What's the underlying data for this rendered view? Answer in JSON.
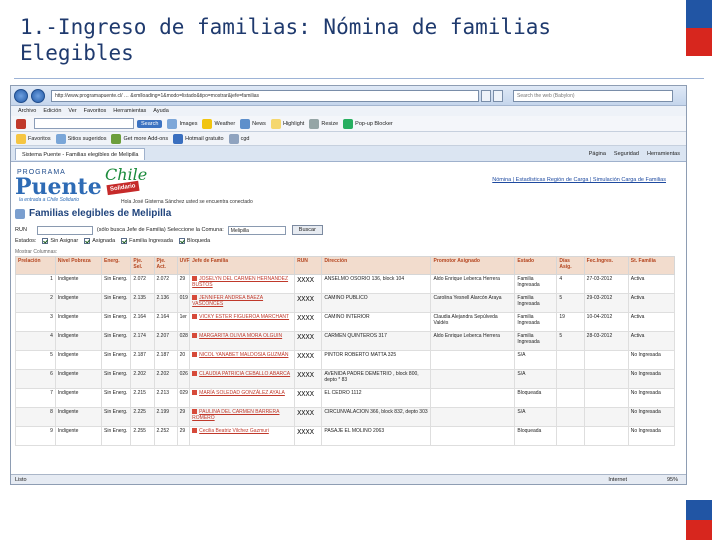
{
  "slide": {
    "title_line1": "1.-Ingreso de familias: Nómina de familias",
    "title_line2": "Elegibles",
    "colors": {
      "flag_blue": "#2155a4",
      "flag_red": "#d7261e",
      "title": "#1f3a6e"
    }
  },
  "browser": {
    "address": "http://www.programapuente.cl/ … &xmlloading=1&modo=listado&tipo=mostrar&jefe=familias",
    "search_placeholder": "Search the web (Babylon)",
    "menu": [
      "Archivo",
      "Edición",
      "Ver",
      "Favoritos",
      "Herramientas",
      "Ayuda"
    ],
    "toolbar1": {
      "search_button": "Search",
      "items": [
        "Images",
        "Weather",
        "News",
        "Highlight",
        "Resize",
        "Pop-up Blocker"
      ]
    },
    "toolbar2": {
      "items": [
        "Favoritos",
        "Sitios sugeridos",
        "Get more Add-ons",
        "Hotmail gratuito",
        "cgd"
      ]
    },
    "tab_title": "Sistema Puente - Familias elegibles de Melipilla",
    "tab_right": [
      "Página",
      "Seguridad",
      "Herramientas"
    ],
    "status_left": "Listo",
    "status_zone": "Internet",
    "status_zoom": "95%"
  },
  "page": {
    "logo": {
      "programa": "PROGRAMA",
      "puente": "Puente",
      "sub": "la entrada a Chile Solidario",
      "chile": "Chile",
      "solidario": "Solidario"
    },
    "top_links": "Nómina | Estadísticas Región de Carga | Simulación Carga de Familias",
    "user_line": "Hola José Gisterna Sánchez usted se encuentra conectado",
    "title": "Familias elegibles de Melipilla",
    "filter": {
      "rut_label": "RUN",
      "hint": "(sólo busca Jefe de Familia) Seleccione la Comuna:",
      "comuna": "Melipilla",
      "button": "Buscar"
    },
    "estados": {
      "label": "Estados:",
      "options": [
        "Sin Asignar",
        "Asignada",
        "Familia Ingresada",
        "Bloqueda"
      ]
    },
    "mostrar": "Mostrar Columnas:",
    "headers": [
      "Prelación",
      "Nivel Pobreza",
      "Energ.",
      "Pje. Sel.",
      "Pje. Act.",
      "UVF",
      "Jefe de Familia",
      "RUN",
      "Dirección",
      "Promotor Asignado",
      "Estado",
      "Días Asig.",
      "Fec.Ingres.",
      "St. Familia"
    ],
    "rows": [
      {
        "n": "1",
        "nivel": "Indigente",
        "energ": "Sin Energ.",
        "sel": "2.072",
        "act": "2.072",
        "uvf": "29",
        "jefe": "JOSELYN DEL CARMEN HERNANDEZ BUSTOS",
        "run": "XXXX",
        "dir": "ANSELMO OSORIO 136, block 104",
        "promotor": "Aldo Enrique Leberca Herrera",
        "estado": "Familia Ingresada",
        "dias": "4",
        "fecha": "27-03-2012",
        "st": "Activa"
      },
      {
        "n": "2",
        "nivel": "Indigente",
        "energ": "Sin Energ.",
        "sel": "2.135",
        "act": "2.136",
        "uvf": "019",
        "jefe": "JENNIFER ANDREA BAEZA VASCONCES",
        "run": "XXXX",
        "dir": "CAMINO PUBLICO",
        "promotor": "Carolina Yesnell Alarcón Araya",
        "estado": "Familia Ingresada",
        "dias": "5",
        "fecha": "29-03-2012",
        "st": "Activa"
      },
      {
        "n": "3",
        "nivel": "Indigente",
        "energ": "Sin Energ.",
        "sel": "2.164",
        "act": "2.164",
        "uvf": "1er",
        "jefe": "VICKY ESTER FIGUEROA MARCHANT",
        "run": "XXXX",
        "dir": "CAMINO INTERIOR",
        "promotor": "Claudia Alejandra Sepúlveda Valdés",
        "estado": "Familia Ingresada",
        "dias": "19",
        "fecha": "10-04-2012",
        "st": "Activa"
      },
      {
        "n": "4",
        "nivel": "Indigente",
        "energ": "Sin Energ.",
        "sel": "2.174",
        "act": "2.207",
        "uvf": "028",
        "jefe": "MARGARITA OLIVIA MORA OLGUIN",
        "run": "XXXX",
        "dir": "CARMEN QUINTEROS 317",
        "promotor": "Aldo Enrique Leberca Herrera",
        "estado": "Familia Ingresada",
        "dias": "5",
        "fecha": "28-03-2012",
        "st": "Activa"
      },
      {
        "n": "5",
        "nivel": "Indigente",
        "energ": "Sin Energ.",
        "sel": "2.187",
        "act": "2.187",
        "uvf": "20",
        "jefe": "NICOL YANABET MALDOSIA GUZMÁN",
        "run": "XXXX",
        "dir": "PINTOR ROBERTO MATTA 325",
        "promotor": "",
        "estado": "S/A",
        "dias": "",
        "fecha": "",
        "st": "No Ingresada"
      },
      {
        "n": "6",
        "nivel": "Indigente",
        "energ": "Sin Energ.",
        "sel": "2.202",
        "act": "2.202",
        "uvf": "026",
        "jefe": "CLAUDIA PATRICIA CEBALLO ABARCA",
        "run": "XXXX",
        "dir": "AVENIDA PADRE DEMETRIO , block 800, depto * 83",
        "promotor": "",
        "estado": "S/A",
        "dias": "",
        "fecha": "",
        "st": "No Ingresada"
      },
      {
        "n": "7",
        "nivel": "Indigente",
        "energ": "Sin Energ.",
        "sel": "2.215",
        "act": "2.213",
        "uvf": "029",
        "jefe": "MARÍA SOLEDAD GONZÁLEZ AYALA",
        "run": "XXXX",
        "dir": "EL CEDRO 1112",
        "promotor": "",
        "estado": "Bloqueada",
        "dias": "",
        "fecha": "",
        "st": "No Ingresada"
      },
      {
        "n": "8",
        "nivel": "Indigente",
        "energ": "Sin Energ.",
        "sel": "2.225",
        "act": "2.199",
        "uvf": "29",
        "jefe": "PAULINA DEL CARMEN BARRERA ROMERO",
        "run": "XXXX",
        "dir": "CIRCUNVALACION 366, block 832, depto 303",
        "promotor": "",
        "estado": "S/A",
        "dias": "",
        "fecha": "",
        "st": "No Ingresada"
      },
      {
        "n": "9",
        "nivel": "Indigente",
        "energ": "Sin Energ.",
        "sel": "2.255",
        "act": "2.252",
        "uvf": "29",
        "jefe": "Cecilia Beatriz Vilchez Gazmuri",
        "run": "XXXX",
        "dir": "PASAJE EL MOLINO 2063",
        "promotor": "",
        "estado": "Bloqueada",
        "dias": "",
        "fecha": "",
        "st": "No Ingresada"
      }
    ]
  }
}
